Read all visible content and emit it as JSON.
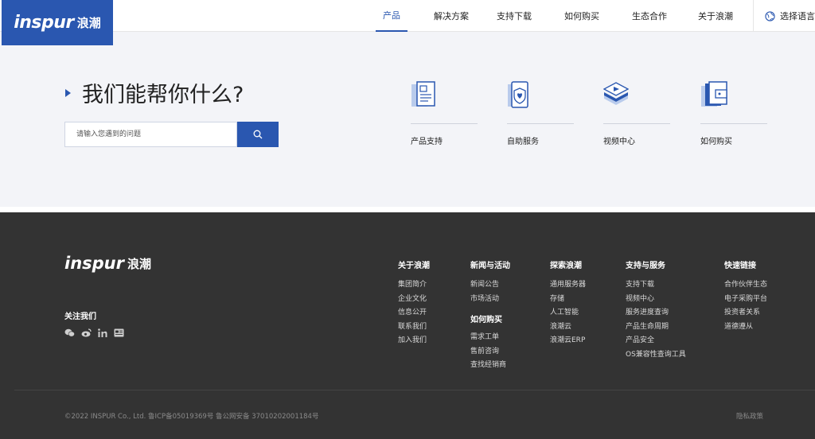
{
  "header": {
    "logo_text": "inspur",
    "logo_cn": "浪潮",
    "nav": [
      {
        "label": "产品",
        "active": true
      },
      {
        "label": "解决方案"
      },
      {
        "label": "支持下载"
      },
      {
        "label": "如何购买"
      },
      {
        "label": "生态合作"
      },
      {
        "label": "关于浪潮"
      }
    ],
    "language_label": "选择语言"
  },
  "hero": {
    "title": "我们能帮你什么?",
    "search_placeholder": "请输入您遇到的问题",
    "services": [
      {
        "label": "产品支持",
        "icon": "document-icon"
      },
      {
        "label": "自助服务",
        "icon": "shield-heart-icon"
      },
      {
        "label": "视频中心",
        "icon": "video-layers-icon"
      },
      {
        "label": "如何购买",
        "icon": "wallet-icon"
      }
    ]
  },
  "footer": {
    "logo_text": "inspur",
    "logo_cn": "浪潮",
    "follow_label": "关注我们",
    "socials": [
      "wechat-icon",
      "weibo-icon",
      "linkedin-icon",
      "toutiao-icon"
    ],
    "columns": [
      {
        "title": "关于浪潮",
        "links": [
          "集团简介",
          "企业文化",
          "信息公开",
          "联系我们",
          "加入我们"
        ]
      },
      {
        "title": "新闻与活动",
        "links": [
          "新闻公告",
          "市场活动"
        ],
        "sub_title": "如何购买",
        "sub_links": [
          "需求工单",
          "售前咨询",
          "查找经销商"
        ]
      },
      {
        "title": "探索浪潮",
        "links": [
          "通用服务器",
          "存储",
          "人工智能",
          "浪潮云",
          "浪潮云ERP"
        ]
      },
      {
        "title": "支持与服务",
        "links": [
          "支持下载",
          "视频中心",
          "服务进度查询",
          "产品生命周期",
          "产品安全",
          "OS兼容性查询工具"
        ]
      },
      {
        "title": "快速链接",
        "links": [
          "合作伙伴生态",
          "电子采购平台",
          "投资者关系",
          "道德遵从"
        ]
      }
    ],
    "copyright": "©2022 INSPUR Co., Ltd. 鲁ICP备05019369号 鲁公网安备 37010202001184号",
    "privacy": "隐私政策"
  },
  "colors": {
    "brand": "#2a57b0",
    "footer_bg": "#333333",
    "hero_bg": "#f3f4f8"
  }
}
